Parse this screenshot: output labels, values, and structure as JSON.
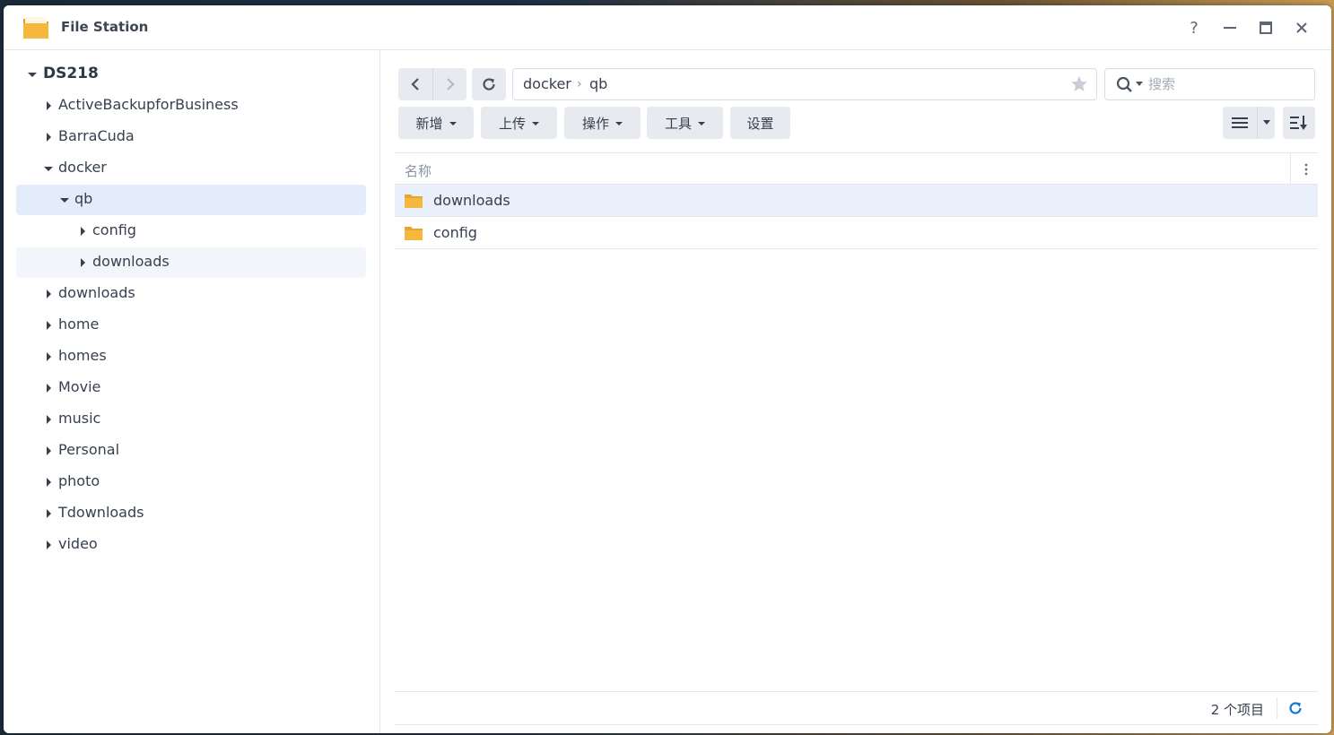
{
  "window": {
    "title": "File Station",
    "help_label": "?",
    "colors": {
      "accent": "#0f7ad6",
      "folder": "#f4b33b",
      "selected_bg": "#e3ecfa"
    }
  },
  "sidebar": {
    "root": "DS218",
    "items": [
      {
        "label": "ActiveBackupforBusiness"
      },
      {
        "label": "BarraCuda"
      },
      {
        "label": "docker"
      },
      {
        "label": "qb"
      },
      {
        "label": "config"
      },
      {
        "label": "downloads"
      },
      {
        "label": "downloads"
      },
      {
        "label": "home"
      },
      {
        "label": "homes"
      },
      {
        "label": "Movie"
      },
      {
        "label": "music"
      },
      {
        "label": "Personal"
      },
      {
        "label": "photo"
      },
      {
        "label": "Tdownloads"
      },
      {
        "label": "video"
      }
    ]
  },
  "path": {
    "segments": [
      "docker",
      "qb"
    ],
    "separator": "›"
  },
  "search": {
    "placeholder": "搜索"
  },
  "toolbar": {
    "create": "新增",
    "upload": "上传",
    "action": "操作",
    "tools": "工具",
    "settings": "设置"
  },
  "list": {
    "column_name": "名称",
    "files": [
      {
        "name": "downloads"
      },
      {
        "name": "config"
      }
    ]
  },
  "status": {
    "count": "2 个项目"
  }
}
